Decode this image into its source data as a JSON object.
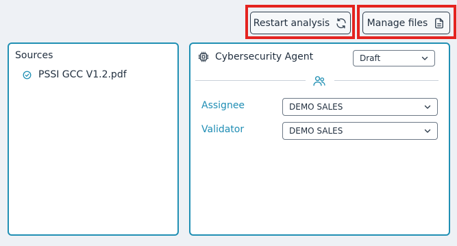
{
  "toolbar": {
    "restart_label": "Restart analysis",
    "manage_label": "Manage files"
  },
  "sources": {
    "title": "Sources",
    "items": [
      {
        "name": "PSSI GCC V1.2.pdf",
        "status_icon": "check-circle-icon"
      }
    ]
  },
  "agent": {
    "name": "Cybersecurity Agent",
    "icon": "cpu-chip-icon",
    "status": "Draft",
    "people_icon": "users-icon",
    "assignee_label": "Assignee",
    "assignee_value": "DEMO SALES",
    "validator_label": "Validator",
    "validator_value": "DEMO SALES"
  },
  "colors": {
    "accent": "#1f8fb3",
    "highlight": "#e4231f",
    "background": "#eef1f5"
  }
}
